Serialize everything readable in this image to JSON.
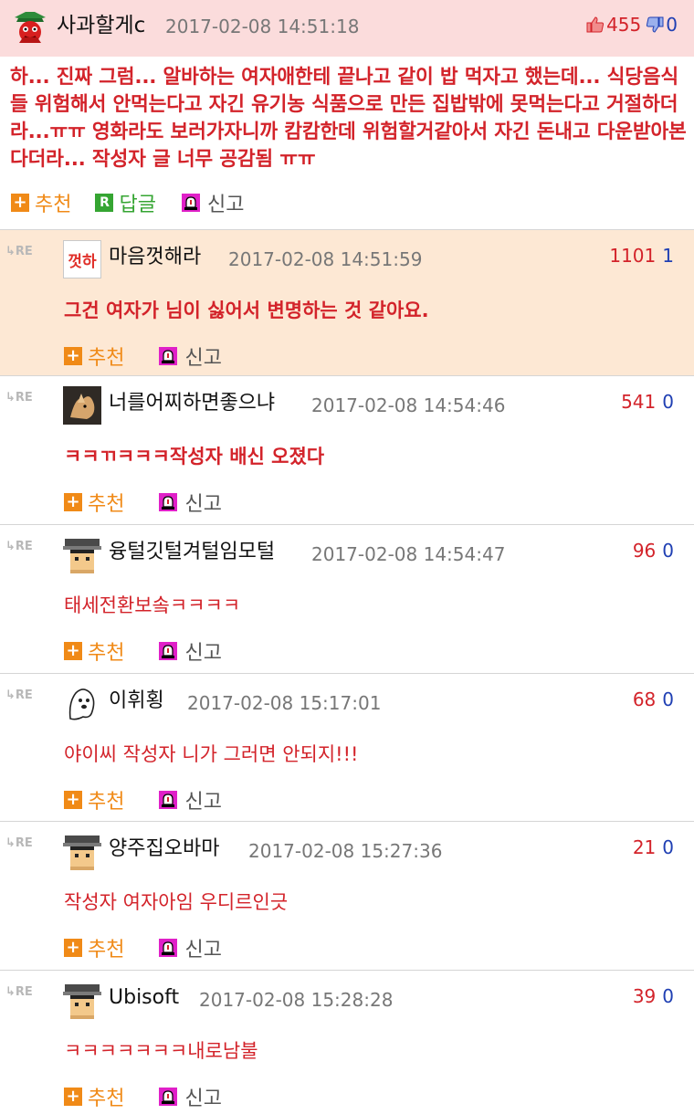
{
  "main_post": {
    "nickname": "사과할게c",
    "date": "2017-02-08 14:51:18",
    "upvotes": "455",
    "downvotes": "0",
    "body": "하... 진짜 그럼... 알바하는 여자애한테 끝나고 같이 밥 먹자고 했는데... 식당음식들 위험해서 안먹는다고 자긴 유기농 식품으로 만든 집밥밖에 못먹는다고 거절하더라...ㅠㅠ 영화라도 보러가자니까 캄캄한데 위험할거같아서 자긴 돈내고 다운받아본다더라... 작성자 글 너무 공감됨 ㅠㅠ",
    "actions": {
      "recommend": "추천",
      "reply": "답글",
      "report": "신고"
    },
    "reply_icon_letter": "R"
  },
  "re_label": "RE",
  "avatar_caption_1": "껏하",
  "comments": [
    {
      "nickname": "마음껏해라",
      "date": "2017-02-08 14:51:59",
      "upvotes": "1101",
      "downvotes": "1",
      "body": "그건 여자가 님이 싫어서 변명하는 것 같아요.",
      "recommend": "추천",
      "report": "신고"
    },
    {
      "nickname": "너를어찌하면좋으냐",
      "date": "2017-02-08 14:54:46",
      "upvotes": "541",
      "downvotes": "0",
      "body": "ㅋㅋㄲㅋㅋㅋ작성자 배신 오졌다",
      "recommend": "추천",
      "report": "신고"
    },
    {
      "nickname": "융털깃털겨털임모털",
      "date": "2017-02-08 14:54:47",
      "upvotes": "96",
      "downvotes": "0",
      "body": "태세전환보솤ㅋㅋㅋㅋ",
      "recommend": "추천",
      "report": "신고"
    },
    {
      "nickname": "이휘횡",
      "date": "2017-02-08 15:17:01",
      "upvotes": "68",
      "downvotes": "0",
      "body": "야이씨 작성자 니가 그러면 안되지!!!",
      "recommend": "추천",
      "report": "신고"
    },
    {
      "nickname": "양주집오바마",
      "date": "2017-02-08 15:27:36",
      "upvotes": "21",
      "downvotes": "0",
      "body": "작성자 여자아임 우디르인긋",
      "recommend": "추천",
      "report": "신고"
    },
    {
      "nickname": "Ubisoft",
      "date": "2017-02-08 15:28:28",
      "upvotes": "39",
      "downvotes": "0",
      "body": "ㅋㅋㅋㅋㅋㅋㅋ내로남불",
      "recommend": "추천",
      "report": "신고"
    }
  ],
  "colors": {
    "accent_red": "#d3232a",
    "down_blue": "#1f3fb3",
    "recommend_orange": "#f08a17",
    "reply_green": "#35a532",
    "main_header_bg": "#fbdcdc",
    "highlight_bg": "#fde8d4"
  },
  "icons": [
    "thumbs-up-icon",
    "thumbs-down-icon",
    "plus-icon",
    "reply-icon",
    "siren-icon",
    "re-arrow-icon"
  ]
}
